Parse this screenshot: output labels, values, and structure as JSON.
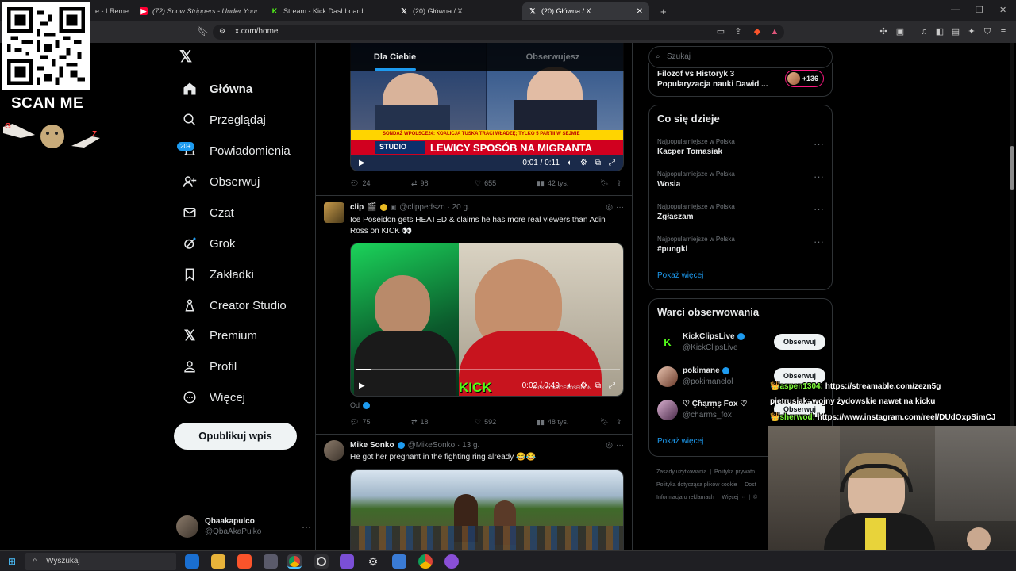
{
  "browser": {
    "tabs": [
      {
        "label": "e - I Remem",
        "active": false
      },
      {
        "label": "(72) Snow Strippers - Under Your",
        "active": false
      },
      {
        "label": "Stream - Kick Dashboard",
        "active": false
      },
      {
        "label": "(20) Główna / X",
        "active": false
      },
      {
        "label": "(20) Główna / X",
        "active": true
      }
    ],
    "new_tab": "+",
    "url": "x.com/home"
  },
  "overlay": {
    "scan_me": "SCAN ME"
  },
  "sidebar": {
    "items": [
      {
        "label": "Główna",
        "icon": "home-icon",
        "active": true
      },
      {
        "label": "Przeglądaj",
        "icon": "search-icon",
        "active": false
      },
      {
        "label": "Powiadomienia",
        "icon": "bell-icon",
        "active": false
      },
      {
        "label": "Obserwuj",
        "icon": "follow-icon",
        "active": false
      },
      {
        "label": "Czat",
        "icon": "mail-icon",
        "active": false
      },
      {
        "label": "Grok",
        "icon": "grok-icon",
        "active": false
      },
      {
        "label": "Zakładki",
        "icon": "bookmark-icon",
        "active": false
      },
      {
        "label": "Creator Studio",
        "icon": "creator-icon",
        "active": false
      },
      {
        "label": "Premium",
        "icon": "x-logo-icon",
        "active": false
      },
      {
        "label": "Profil",
        "icon": "person-icon",
        "active": false
      },
      {
        "label": "Więcej",
        "icon": "more-circle-icon",
        "active": false
      }
    ],
    "notifications_badge": "20+",
    "post_button": "Opublikuj wpis",
    "account": {
      "name": "Qbaakapulco",
      "handle": "@QbaAkaPulko"
    }
  },
  "feed": {
    "tabs": [
      "Dla Ciebie",
      "Obserwujesz"
    ],
    "tweet1": {
      "banner_top": "SONDAŻ WPOLSCE24: KOALICJA TUSKA TRACI WŁADZĘ; TYLKO 5 PARTII W SEJMIE",
      "banner_main": "LEWICY SPOSÓB NA MIGRANTA",
      "banner_studio": "STUDIO",
      "video_time": "0:01 / 0:11",
      "replies": "24",
      "reposts": "98",
      "likes": "655",
      "views": "42 tys."
    },
    "tweet2": {
      "name": "clip",
      "handle": "@clippedszn · 20 g.",
      "text": "Ice Poseidon gets HEATED & claims he has more real viewers than Adin Ross on KICK 👀",
      "video_time": "0:02 / 0:49",
      "watermark": "KICK",
      "video_credit": "KICK.COM/ICEPOSEIDON",
      "from_label": "Od",
      "replies": "75",
      "reposts": "18",
      "likes": "592",
      "views": "48 tys."
    },
    "tweet3": {
      "name": "Mike Sonko",
      "handle": "@MikeSonko · 13 g.",
      "text": "He got her pregnant in the fighting ring already 😂😂"
    }
  },
  "right": {
    "search_placeholder": "Szukaj",
    "space": {
      "line1": "Filozof vs Historyk 3",
      "line2": "Popularyzacja nauki Dawid ...",
      "count": "+136"
    },
    "trends_title": "Co się dzieje",
    "trends": [
      {
        "category": "Najpopularniejsze w Polska",
        "name": "Kacper Tomasiak"
      },
      {
        "category": "Najpopularniejsze w Polska",
        "name": "Wosia"
      },
      {
        "category": "Najpopularniejsze w Polska",
        "name": "Zgłaszam"
      },
      {
        "category": "Najpopularniejsze w Polska",
        "name": "#pungkl"
      }
    ],
    "show_more": "Pokaż więcej",
    "who_title": "Warci obserwowania",
    "who": [
      {
        "name": "KickClipsLive",
        "handle": "@KickClipsLive",
        "button": "Obserwuj"
      },
      {
        "name": "pokimane",
        "handle": "@pokimanelol",
        "button": "Obserwuj"
      },
      {
        "name": "♡ Çħąrṃṣ Fox ♡",
        "handle": "@charms_fox",
        "button": "Obserwuj"
      }
    ],
    "who_more": "Pokaż więcej",
    "footer": [
      "Zasady użytkowania",
      "Polityka prywatn",
      "Polityka dotycząca plików cookie",
      "Dost",
      "Informacja o reklamach",
      "Więcej ···",
      "©"
    ]
  },
  "chat": [
    {
      "user": "aspen1304:",
      "text": "https://streamable.com/zezn5g",
      "color": "#7fff3a"
    },
    {
      "user": "pietrusiak:",
      "text": "wojny żydowskie nawet na kicku",
      "color": "#ffffff"
    },
    {
      "user": "sherwod:",
      "text": "https://www.instagram.com/reel/DUdOxpSimCJ",
      "color": "#7fff3a"
    }
  ],
  "taskbar": {
    "search": "Wyszukaj"
  }
}
